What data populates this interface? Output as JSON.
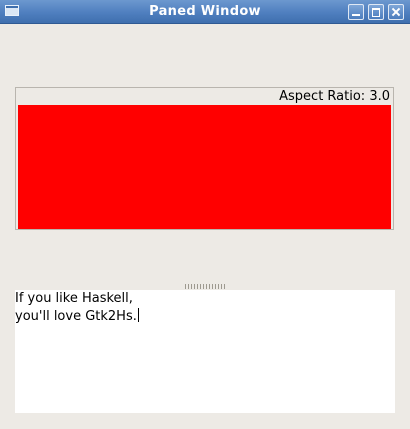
{
  "window": {
    "title": "Paned Window",
    "aspect_label": "Aspect Ratio: 3.0",
    "drawing_color": "#ff0000",
    "title_color": "#4f7fbf"
  },
  "textview": {
    "lines": [
      "If you like Haskell,",
      "you'll love Gtk2Hs."
    ]
  },
  "icons": [
    "window-menu-icon",
    "minimize-icon",
    "maximize-icon",
    "close-icon"
  ]
}
